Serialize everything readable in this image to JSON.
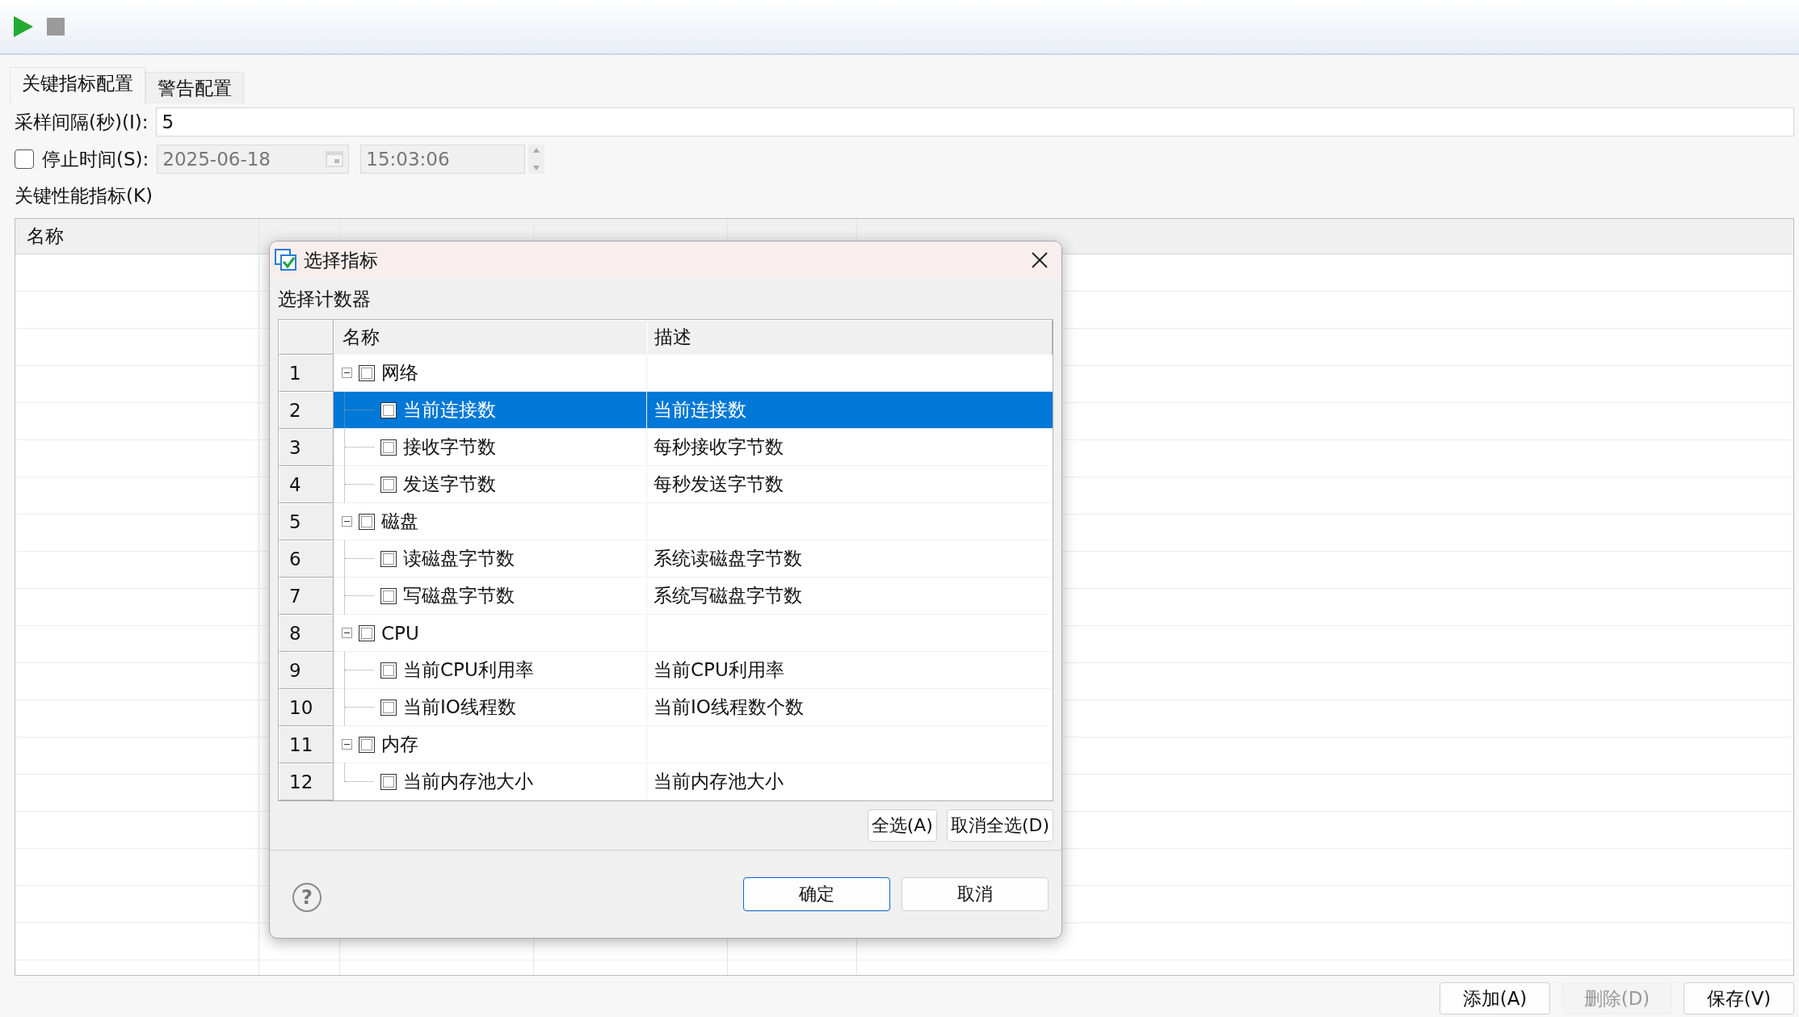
{
  "tabs": [
    {
      "label": "关键指标配置",
      "selected": true
    },
    {
      "label": "警告配置",
      "selected": false
    }
  ],
  "interval": {
    "label": "采样间隔(秒)(I):",
    "value": "5"
  },
  "stop_time": {
    "label": "停止时间(S):",
    "checked": false,
    "disabled": true,
    "date": "2025-06-18",
    "time": "15:03:06"
  },
  "kpi_table": {
    "label": "关键性能指标(K)",
    "columns": [
      "名称"
    ]
  },
  "buttons": [
    {
      "label": "添加(A)",
      "disabled": false
    },
    {
      "label": "删除(D)",
      "disabled": true
    },
    {
      "label": "保存(V)",
      "disabled": false
    }
  ],
  "dialog": {
    "title": "选择指标",
    "section_label": "选择计数器",
    "columns": [
      "名称",
      "描述"
    ],
    "rows": [
      {
        "number": "1",
        "name": "网络",
        "checked": false,
        "expanded": true,
        "selected": false,
        "children": [
          {
            "number": "2",
            "name": "当前连接数",
            "description": "当前连接数",
            "checked": false,
            "selected": true
          },
          {
            "number": "3",
            "name": "接收字节数",
            "description": "每秒接收字节数",
            "checked": false,
            "selected": false
          },
          {
            "number": "4",
            "name": "发送字节数",
            "description": "每秒发送字节数",
            "checked": false,
            "selected": false
          }
        ]
      },
      {
        "number": "5",
        "name": "磁盘",
        "checked": false,
        "expanded": true,
        "selected": false,
        "children": [
          {
            "number": "6",
            "name": "读磁盘字节数",
            "description": "系统读磁盘字节数",
            "checked": false,
            "selected": false
          },
          {
            "number": "7",
            "name": "写磁盘字节数",
            "description": "系统写磁盘字节数",
            "checked": false,
            "selected": false
          }
        ]
      },
      {
        "number": "8",
        "name": "CPU",
        "checked": false,
        "expanded": true,
        "selected": false,
        "children": [
          {
            "number": "9",
            "name": "当前CPU利用率",
            "description": "当前CPU利用率",
            "checked": false,
            "selected": false
          },
          {
            "number": "10",
            "name": "当前IO线程数",
            "description": "当前IO线程数个数",
            "checked": false,
            "selected": false
          }
        ]
      },
      {
        "number": "11",
        "name": "内存",
        "checked": false,
        "expanded": true,
        "selected": false,
        "children": [
          {
            "number": "12",
            "name": "当前内存池大小",
            "description": "当前内存池大小",
            "checked": false,
            "selected": false
          }
        ]
      }
    ],
    "select_buttons": [
      "全选(A)",
      "取消全选(D)"
    ],
    "help": "?",
    "buttons": [
      {
        "label": "确定",
        "default": true
      },
      {
        "label": "取消",
        "default": false
      }
    ]
  }
}
